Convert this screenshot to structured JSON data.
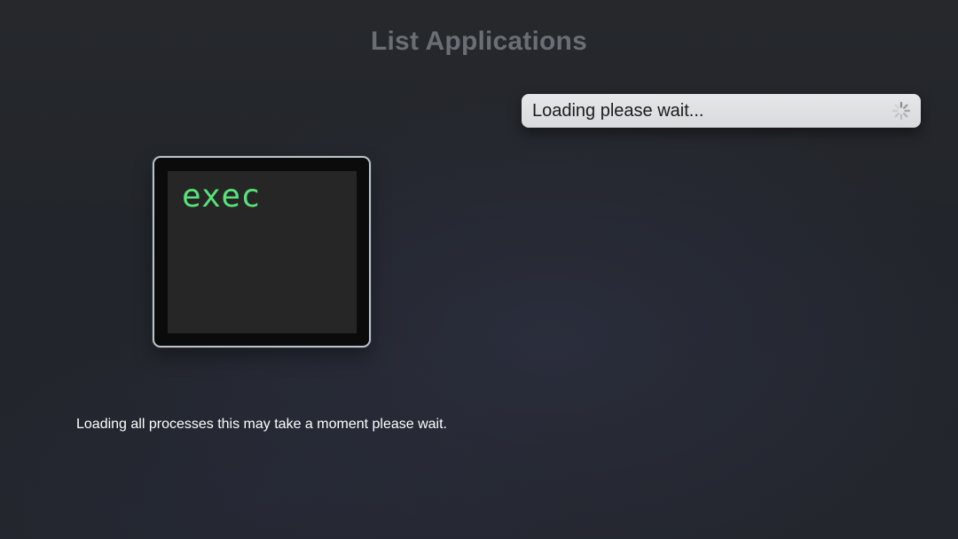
{
  "page": {
    "title": "List Applications"
  },
  "loading_banner": {
    "text": "Loading please wait...",
    "icon": "spinner-icon",
    "background": "#e2e3e5",
    "text_color": "#1b1c1e"
  },
  "apps": [
    {
      "label": "exec",
      "label_color": "#58e27a",
      "icon": "terminal-icon"
    }
  ],
  "status": {
    "text": "Loading all processes this may take a moment please wait."
  }
}
